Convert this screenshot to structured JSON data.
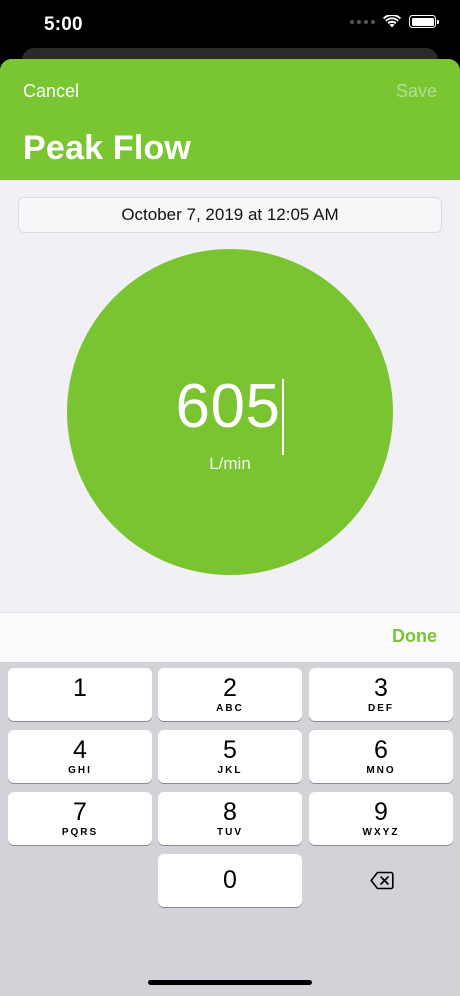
{
  "status": {
    "time": "5:00"
  },
  "header": {
    "cancel_label": "Cancel",
    "save_label": "Save",
    "title": "Peak Flow"
  },
  "date": {
    "text": "October 7, 2019 at 12:05 AM"
  },
  "reading": {
    "value": "605",
    "unit": "L/min"
  },
  "accessory": {
    "done_label": "Done"
  },
  "keypad": {
    "keys": [
      {
        "digit": "1",
        "letters": ""
      },
      {
        "digit": "2",
        "letters": "ABC"
      },
      {
        "digit": "3",
        "letters": "DEF"
      },
      {
        "digit": "4",
        "letters": "GHI"
      },
      {
        "digit": "5",
        "letters": "JKL"
      },
      {
        "digit": "6",
        "letters": "MNO"
      },
      {
        "digit": "7",
        "letters": "PQRS"
      },
      {
        "digit": "8",
        "letters": "TUV"
      },
      {
        "digit": "9",
        "letters": "WXYZ"
      },
      {
        "digit": "0",
        "letters": ""
      }
    ],
    "delete_icon": "backspace-icon"
  },
  "colors": {
    "accent": "#79c532",
    "background": "#f1f1f5",
    "keyboard": "#d1d3d9"
  }
}
